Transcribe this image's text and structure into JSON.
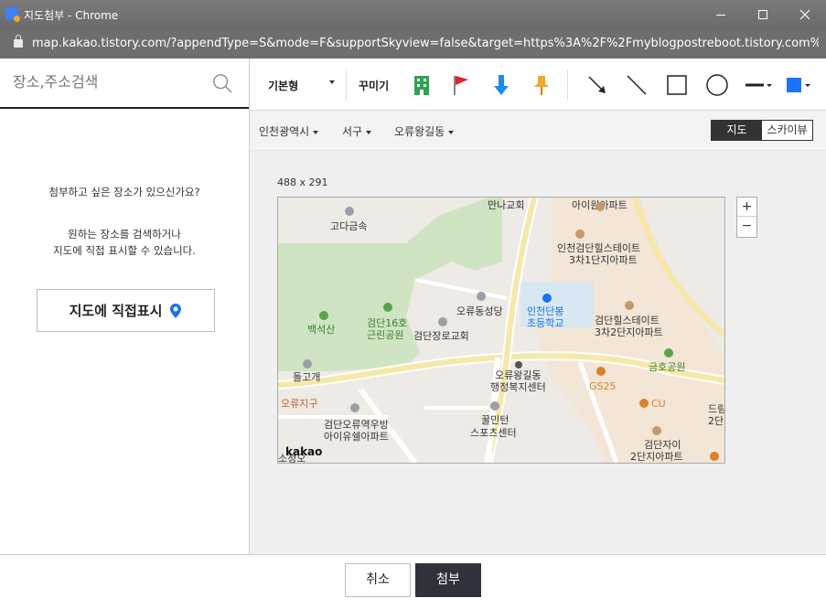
{
  "window": {
    "title": "지도첨부 - Chrome",
    "url": "map.kakao.tistory.com/?appendType=S&mode=F&supportSkyview=false&target=https%3A%2F%2Fmyblogpostreboot.tistory.com%..."
  },
  "search": {
    "placeholder": "장소,주소검색"
  },
  "left": {
    "prompt": "첨부하고 싶은 장소가 있으신가요?",
    "hint_line1": "원하는 장소를 검색하거나",
    "hint_line2": "지도에 직접 표시할 수 있습니다.",
    "direct_button": "지도에 직접표시"
  },
  "toolbar": {
    "base_style": "기본형",
    "decorate": "꾸미기",
    "icons": [
      "building-icon",
      "flag-icon",
      "arrow-down-icon",
      "pushpin-icon",
      "arrow-line-icon",
      "line-icon",
      "rectangle-icon",
      "circle-icon",
      "line-style-icon",
      "color-picker-icon"
    ],
    "accent_color": "#1a73ff"
  },
  "region": {
    "city": "인천광역시",
    "district": "서구",
    "dong": "오류왕길동"
  },
  "maptype": {
    "map": "지도",
    "skyview": "스카이뷰"
  },
  "map": {
    "size_label": "488 x 291",
    "zoom_in": "+",
    "zoom_out": "−",
    "brand": "kakao",
    "labels": {
      "l1": "만나교회",
      "l2": "아이원아파트",
      "l3": "고다금속",
      "l4": "인천검단힐스테이트",
      "l5": "3차1단지아파트",
      "l6": "백석산",
      "l7": "검단16호",
      "l8": "근린공원",
      "l9": "오류동성당",
      "l10": "인천단봉",
      "l11": "초등학교",
      "l12": "검단힐스테이트",
      "l13": "3차2단지아파트",
      "l14": "검단장로교회",
      "l15": "돌고개",
      "l16": "오류왕길동",
      "l17": "행정복지센터",
      "l18": "GS25",
      "l19": "금호공원",
      "l20": "오류지구",
      "l21": "CU",
      "l22": "꿀민턴",
      "l23": "스포츠센터",
      "l24": "검단오류역우방",
      "l25": "아이유쉘아파트",
      "l26": "검단자이",
      "l27": "2단지아파트",
      "l28": "드림",
      "l29": "2단",
      "l30": "소정오"
    }
  },
  "footer": {
    "cancel": "취소",
    "attach": "첨부"
  }
}
